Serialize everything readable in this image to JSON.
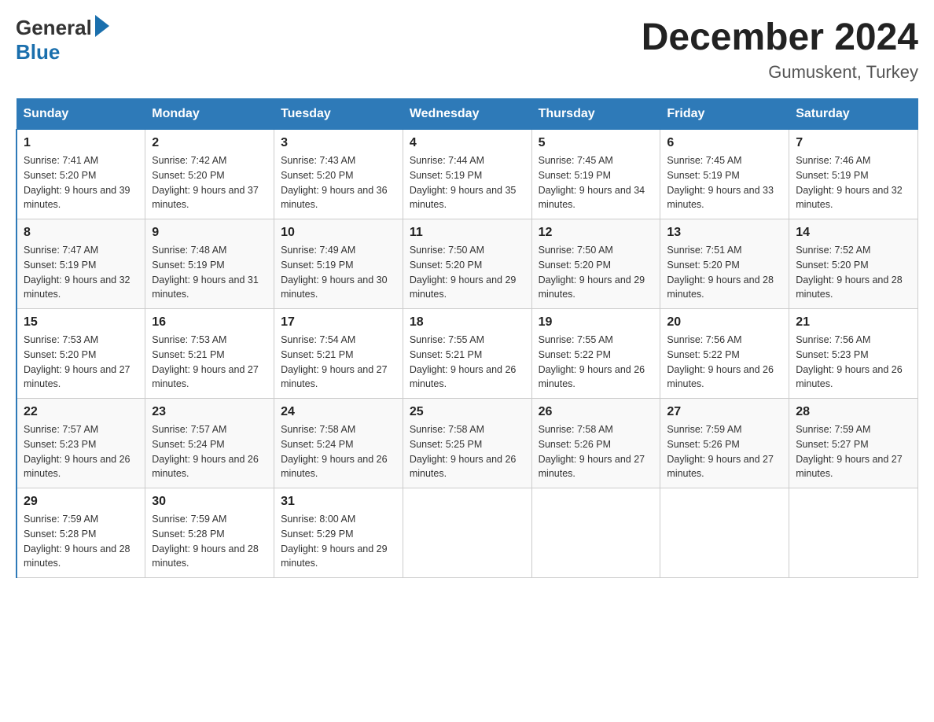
{
  "header": {
    "logo_general": "General",
    "logo_blue": "Blue",
    "month_title": "December 2024",
    "location": "Gumuskent, Turkey"
  },
  "calendar": {
    "days_of_week": [
      "Sunday",
      "Monday",
      "Tuesday",
      "Wednesday",
      "Thursday",
      "Friday",
      "Saturday"
    ],
    "weeks": [
      [
        {
          "day": "1",
          "sunrise": "7:41 AM",
          "sunset": "5:20 PM",
          "daylight": "9 hours and 39 minutes."
        },
        {
          "day": "2",
          "sunrise": "7:42 AM",
          "sunset": "5:20 PM",
          "daylight": "9 hours and 37 minutes."
        },
        {
          "day": "3",
          "sunrise": "7:43 AM",
          "sunset": "5:20 PM",
          "daylight": "9 hours and 36 minutes."
        },
        {
          "day": "4",
          "sunrise": "7:44 AM",
          "sunset": "5:19 PM",
          "daylight": "9 hours and 35 minutes."
        },
        {
          "day": "5",
          "sunrise": "7:45 AM",
          "sunset": "5:19 PM",
          "daylight": "9 hours and 34 minutes."
        },
        {
          "day": "6",
          "sunrise": "7:45 AM",
          "sunset": "5:19 PM",
          "daylight": "9 hours and 33 minutes."
        },
        {
          "day": "7",
          "sunrise": "7:46 AM",
          "sunset": "5:19 PM",
          "daylight": "9 hours and 32 minutes."
        }
      ],
      [
        {
          "day": "8",
          "sunrise": "7:47 AM",
          "sunset": "5:19 PM",
          "daylight": "9 hours and 32 minutes."
        },
        {
          "day": "9",
          "sunrise": "7:48 AM",
          "sunset": "5:19 PM",
          "daylight": "9 hours and 31 minutes."
        },
        {
          "day": "10",
          "sunrise": "7:49 AM",
          "sunset": "5:19 PM",
          "daylight": "9 hours and 30 minutes."
        },
        {
          "day": "11",
          "sunrise": "7:50 AM",
          "sunset": "5:20 PM",
          "daylight": "9 hours and 29 minutes."
        },
        {
          "day": "12",
          "sunrise": "7:50 AM",
          "sunset": "5:20 PM",
          "daylight": "9 hours and 29 minutes."
        },
        {
          "day": "13",
          "sunrise": "7:51 AM",
          "sunset": "5:20 PM",
          "daylight": "9 hours and 28 minutes."
        },
        {
          "day": "14",
          "sunrise": "7:52 AM",
          "sunset": "5:20 PM",
          "daylight": "9 hours and 28 minutes."
        }
      ],
      [
        {
          "day": "15",
          "sunrise": "7:53 AM",
          "sunset": "5:20 PM",
          "daylight": "9 hours and 27 minutes."
        },
        {
          "day": "16",
          "sunrise": "7:53 AM",
          "sunset": "5:21 PM",
          "daylight": "9 hours and 27 minutes."
        },
        {
          "day": "17",
          "sunrise": "7:54 AM",
          "sunset": "5:21 PM",
          "daylight": "9 hours and 27 minutes."
        },
        {
          "day": "18",
          "sunrise": "7:55 AM",
          "sunset": "5:21 PM",
          "daylight": "9 hours and 26 minutes."
        },
        {
          "day": "19",
          "sunrise": "7:55 AM",
          "sunset": "5:22 PM",
          "daylight": "9 hours and 26 minutes."
        },
        {
          "day": "20",
          "sunrise": "7:56 AM",
          "sunset": "5:22 PM",
          "daylight": "9 hours and 26 minutes."
        },
        {
          "day": "21",
          "sunrise": "7:56 AM",
          "sunset": "5:23 PM",
          "daylight": "9 hours and 26 minutes."
        }
      ],
      [
        {
          "day": "22",
          "sunrise": "7:57 AM",
          "sunset": "5:23 PM",
          "daylight": "9 hours and 26 minutes."
        },
        {
          "day": "23",
          "sunrise": "7:57 AM",
          "sunset": "5:24 PM",
          "daylight": "9 hours and 26 minutes."
        },
        {
          "day": "24",
          "sunrise": "7:58 AM",
          "sunset": "5:24 PM",
          "daylight": "9 hours and 26 minutes."
        },
        {
          "day": "25",
          "sunrise": "7:58 AM",
          "sunset": "5:25 PM",
          "daylight": "9 hours and 26 minutes."
        },
        {
          "day": "26",
          "sunrise": "7:58 AM",
          "sunset": "5:26 PM",
          "daylight": "9 hours and 27 minutes."
        },
        {
          "day": "27",
          "sunrise": "7:59 AM",
          "sunset": "5:26 PM",
          "daylight": "9 hours and 27 minutes."
        },
        {
          "day": "28",
          "sunrise": "7:59 AM",
          "sunset": "5:27 PM",
          "daylight": "9 hours and 27 minutes."
        }
      ],
      [
        {
          "day": "29",
          "sunrise": "7:59 AM",
          "sunset": "5:28 PM",
          "daylight": "9 hours and 28 minutes."
        },
        {
          "day": "30",
          "sunrise": "7:59 AM",
          "sunset": "5:28 PM",
          "daylight": "9 hours and 28 minutes."
        },
        {
          "day": "31",
          "sunrise": "8:00 AM",
          "sunset": "5:29 PM",
          "daylight": "9 hours and 29 minutes."
        },
        null,
        null,
        null,
        null
      ]
    ]
  }
}
